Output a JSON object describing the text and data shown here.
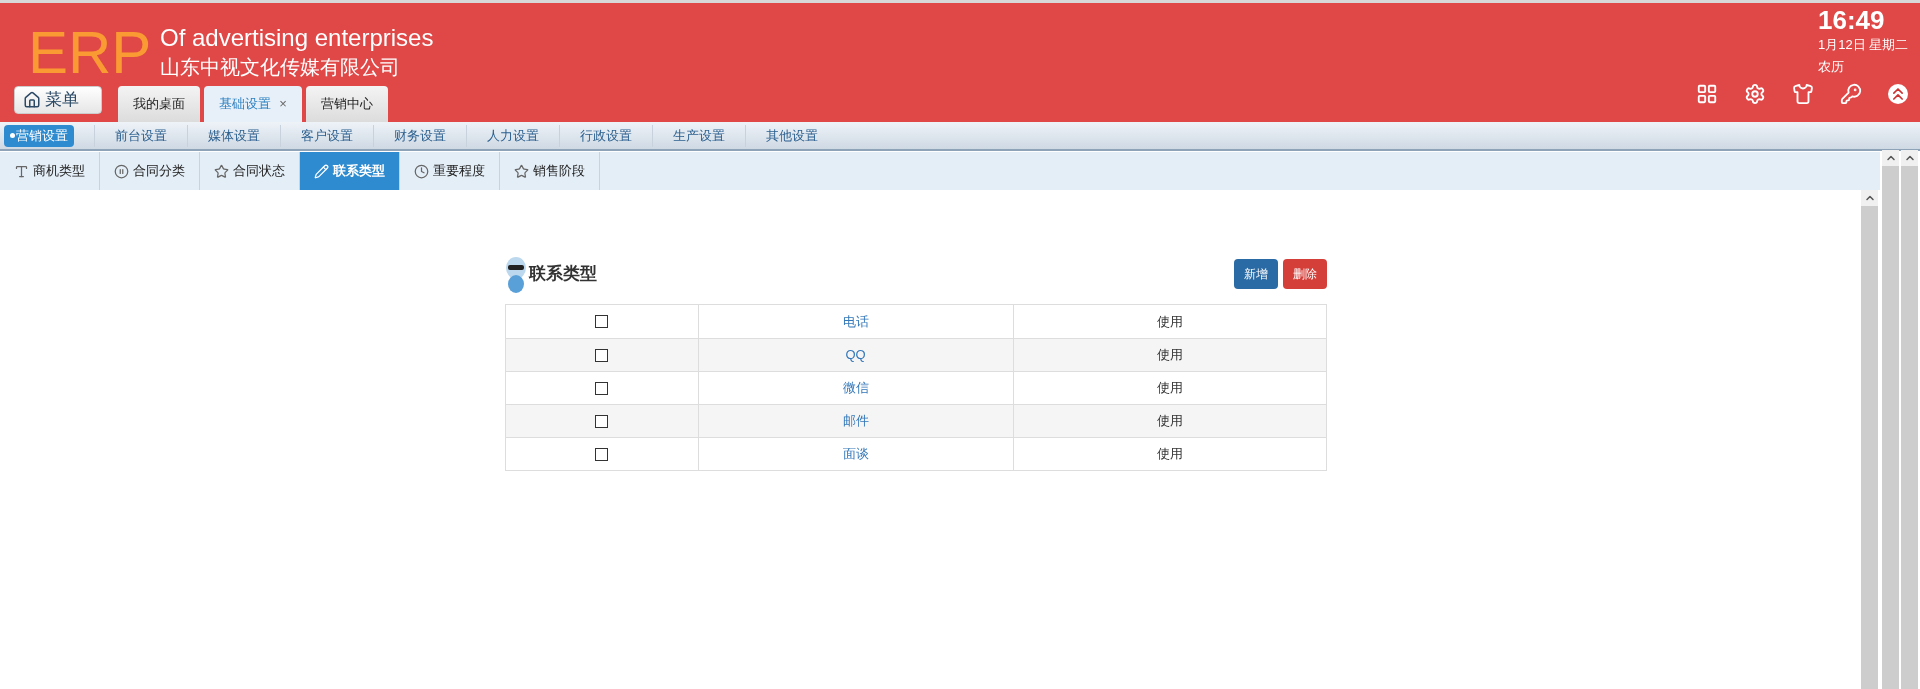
{
  "header": {
    "logo": "ERP",
    "title": "Of advertising enterprises",
    "company": "山东中视文化传媒有限公司",
    "menu_button": "菜单",
    "clock": {
      "time": "16:49",
      "date": "1月12日 星期二",
      "lunar": "农历"
    }
  },
  "tabs": [
    {
      "label": "我的桌面",
      "selected": false
    },
    {
      "label": "基础设置",
      "selected": true,
      "close": "×"
    },
    {
      "label": "营销中心",
      "selected": false
    }
  ],
  "nav": [
    {
      "label": "营销设置",
      "selected": true
    },
    {
      "label": "前台设置",
      "selected": false
    },
    {
      "label": "媒体设置",
      "selected": false
    },
    {
      "label": "客户设置",
      "selected": false
    },
    {
      "label": "财务设置",
      "selected": false
    },
    {
      "label": "人力设置",
      "selected": false
    },
    {
      "label": "行政设置",
      "selected": false
    },
    {
      "label": "生产设置",
      "selected": false
    },
    {
      "label": "其他设置",
      "selected": false
    }
  ],
  "subtabs": [
    {
      "label": "商机类型",
      "selected": false
    },
    {
      "label": "合同分类",
      "selected": false
    },
    {
      "label": "合同状态",
      "selected": false
    },
    {
      "label": "联系类型",
      "selected": true
    },
    {
      "label": "重要程度",
      "selected": false
    },
    {
      "label": "销售阶段",
      "selected": false
    }
  ],
  "panel": {
    "title": "联系类型",
    "buttons": [
      {
        "label": "新增",
        "kind": "primary"
      },
      {
        "label": "删除",
        "kind": "danger"
      }
    ],
    "rows": [
      {
        "checked": false,
        "name": "电话",
        "status": "使用"
      },
      {
        "checked": false,
        "name": "QQ",
        "status": "使用"
      },
      {
        "checked": false,
        "name": "微信",
        "status": "使用"
      },
      {
        "checked": false,
        "name": "邮件",
        "status": "使用"
      },
      {
        "checked": false,
        "name": "面谈",
        "status": "使用"
      }
    ]
  }
}
